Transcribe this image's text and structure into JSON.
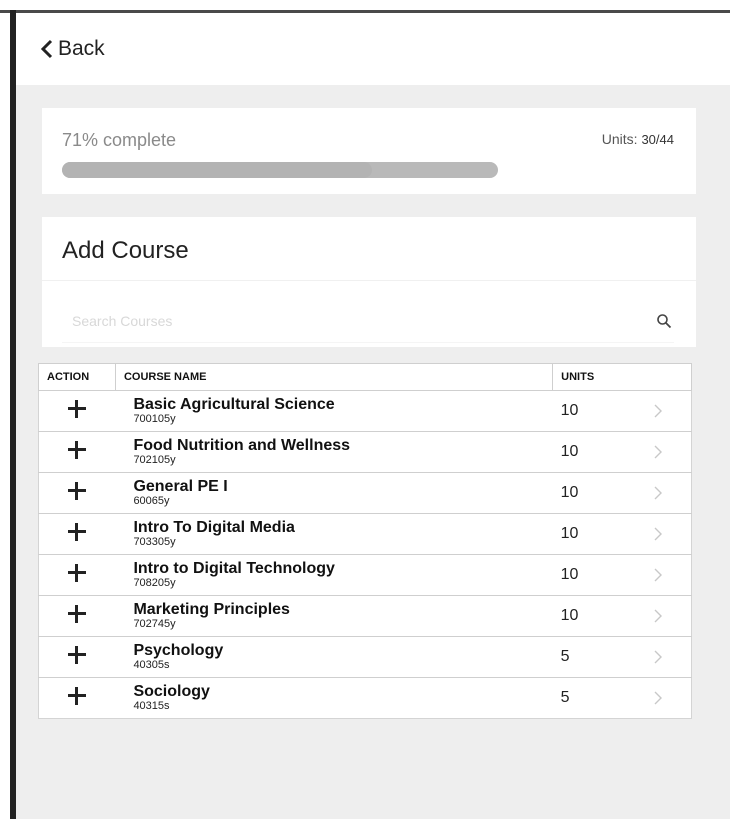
{
  "header": {
    "back_label": "Back"
  },
  "progress": {
    "percent_text": "71% complete",
    "percent_value": 71,
    "units_label": "Units:",
    "units_value": "30/44"
  },
  "add_course": {
    "title": "Add Course",
    "search_placeholder": "Search Courses"
  },
  "table": {
    "headers": {
      "action": "ACTION",
      "course_name": "COURSE NAME",
      "units": "UNITS"
    },
    "rows": [
      {
        "name": "Basic Agricultural Science",
        "code": "700105y",
        "units": "10"
      },
      {
        "name": "Food Nutrition and Wellness",
        "code": "702105y",
        "units": "10"
      },
      {
        "name": "General PE I",
        "code": "60065y",
        "units": "10"
      },
      {
        "name": "Intro To Digital Media",
        "code": "703305y",
        "units": "10"
      },
      {
        "name": "Intro to Digital Technology",
        "code": "708205y",
        "units": "10"
      },
      {
        "name": "Marketing Principles",
        "code": "702745y",
        "units": "10"
      },
      {
        "name": "Psychology",
        "code": "40305s",
        "units": "5"
      },
      {
        "name": "Sociology",
        "code": "40315s",
        "units": "5"
      }
    ]
  },
  "icons": {
    "back": "chevron-left-icon",
    "search": "search-icon",
    "add": "plus-icon",
    "row_chevron": "chevron-right-icon"
  }
}
